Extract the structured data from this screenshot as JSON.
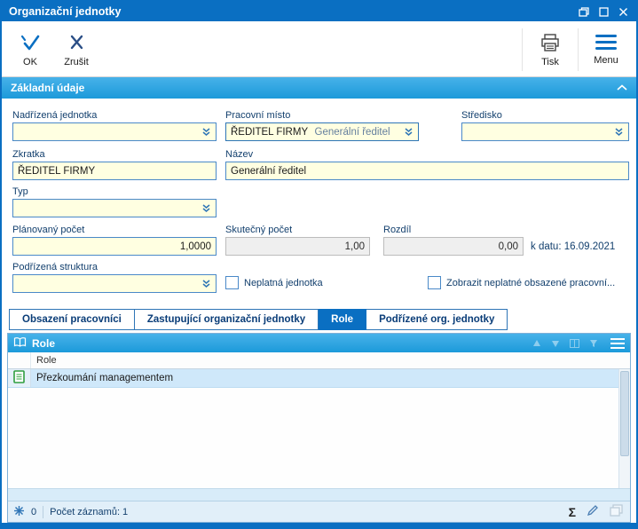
{
  "window": {
    "title": "Organizační jednotky"
  },
  "toolbar": {
    "ok_label": "OK",
    "cancel_label": "Zrušit",
    "print_label": "Tisk",
    "menu_label": "Menu"
  },
  "section": {
    "title": "Základní údaje"
  },
  "form": {
    "nadrizena_jednotka": {
      "label": "Nadřízená jednotka",
      "value": ""
    },
    "pracovni_misto": {
      "label": "Pracovní místo",
      "code": "ŘEDITEL FIRMY",
      "name": "Generální ředitel"
    },
    "stredisko": {
      "label": "Středisko",
      "value": ""
    },
    "zkratka": {
      "label": "Zkratka",
      "value": "ŘEDITEL FIRMY"
    },
    "nazev": {
      "label": "Název",
      "value": "Generální ředitel"
    },
    "typ": {
      "label": "Typ",
      "value": ""
    },
    "planovany_pocet": {
      "label": "Plánovaný počet",
      "value": "1,0000"
    },
    "skutecny_pocet": {
      "label": "Skutečný počet",
      "value": "1,00"
    },
    "rozdil": {
      "label": "Rozdíl",
      "value": "0,00"
    },
    "k_datu": "k datu: 16.09.2021",
    "podrizena_struktura": {
      "label": "Podřízená struktura",
      "value": ""
    },
    "neplatna_jednotka_label": "Neplatná jednotka",
    "zobrazit_neplatne_label": "Zobrazit neplatné obsazené pracovní..."
  },
  "tabs": [
    {
      "label": "Obsazení pracovníci",
      "active": false
    },
    {
      "label": "Zastupující organizační jednotky",
      "active": false
    },
    {
      "label": "Role",
      "active": true
    },
    {
      "label": "Podřízené org. jednotky",
      "active": false
    }
  ],
  "grid": {
    "panel_title": "Role",
    "column_header": "Role",
    "rows": [
      {
        "role": "Přezkoumání managementem"
      }
    ]
  },
  "statusbar": {
    "left_count": "0",
    "record_count": "Počet záznamů: 1",
    "sum_symbol": "Σ"
  },
  "colors": {
    "titlebar": "#0a6fc2",
    "section_header": "#2aa3e0",
    "field_bg": "#ffffe1",
    "active_tab": "#0a6fc2",
    "selected_row": "#cfe8fa"
  }
}
